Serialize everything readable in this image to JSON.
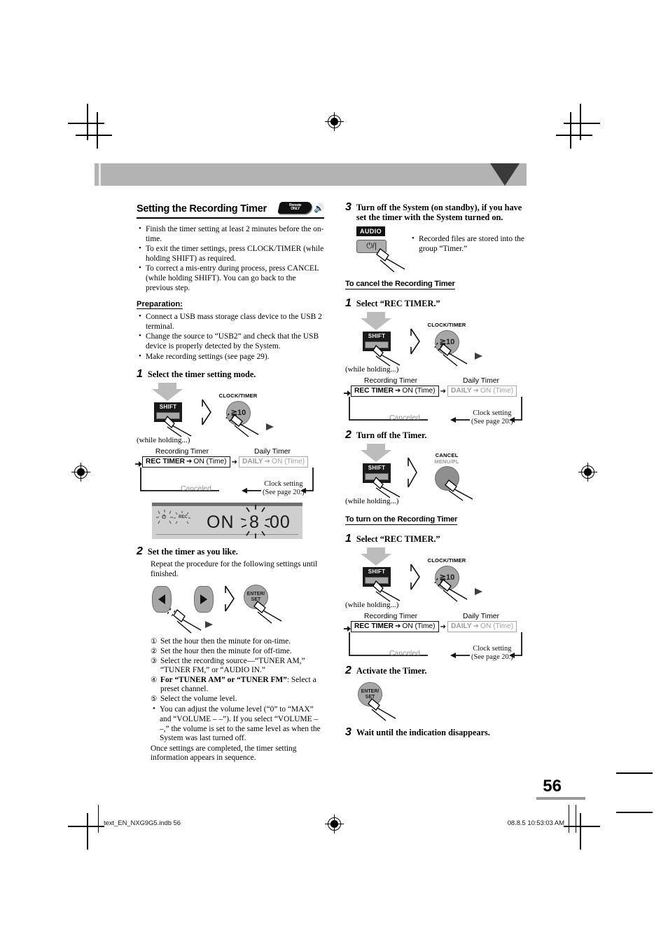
{
  "page": {
    "number": "56",
    "footer_left": "text_EN_NXG9G5.indb   56",
    "footer_right": "08.8.5   10:53:03 AM"
  },
  "left": {
    "title": "Setting the Recording Timer",
    "remote_badge": {
      "line1": "Remote",
      "line2": "ONLY"
    },
    "bullets": [
      "Finish the timer setting at least 2 minutes before the on-time.",
      "To exit the timer settings, press CLOCK/TIMER (while holding SHIFT) as required.",
      "To correct a mis-entry during process, press CANCEL (while holding SHIFT). You can go back to the previous step."
    ],
    "preparation_heading": "Preparation:",
    "preparation_bullets": [
      "Connect a USB mass storage class device to the USB 2 terminal.",
      "Change the source to “USB2” and check that the USB device is properly detected by the System.",
      "Make recording settings (see page 29)."
    ],
    "step1": {
      "n": "1",
      "text": "Select the timer setting mode."
    },
    "art1": {
      "shift_label": "SHIFT",
      "clock_label": "CLOCK/TIMER",
      "key_label": "≧10",
      "while_holding": "(while holding...)"
    },
    "flow": {
      "head_left": "Recording Timer",
      "head_right": "Daily Timer",
      "box1_bold": "REC TIMER",
      "box1_rest": "ON (Time)",
      "box2_bold": "DAILY",
      "box2_rest": "ON (Time)",
      "canceled": "Canceled",
      "clock_l1": "Clock setting",
      "clock_l2": "(See page 20.)"
    },
    "lcd": {
      "rec": "REC",
      "on": "ON",
      "hour": "8",
      "minute": "00"
    },
    "step2": {
      "n": "2",
      "text": "Set the timer as you like."
    },
    "step2_intro": "Repeat the procedure for the following settings until finished.",
    "art2": {
      "enter_l1": "ENTER/",
      "enter_l2": "SET"
    },
    "step2_items": [
      {
        "num": "①",
        "text": "Set the hour then the minute for on-time."
      },
      {
        "num": "②",
        "text": "Set the hour then the minute for off-time."
      },
      {
        "num": "③",
        "text": "Select the recording source—“TUNER AM,” “TUNER FM,” or “AUDIO IN.”"
      },
      {
        "num": "④",
        "text_bold": "For “TUNER AM” or “TUNER FM”",
        "text": ": Select a preset channel."
      },
      {
        "num": "⑤",
        "text": "Select the volume level."
      }
    ],
    "step2_note": "You can adjust the volume level (“0” to “MAX” and “VOLUME – –”). If you select “VOLUME – –,” the volume is set to the same level as when the System was last turned off.",
    "step2_tail": "Once settings are completed, the timer setting information appears in sequence."
  },
  "right": {
    "step3": {
      "n": "3",
      "text": "Turn off the System (on standby), if you have set the timer with the System turned on."
    },
    "audio": {
      "badge": "AUDIO",
      "power_glyph": "⏻/|"
    },
    "step3_note": "Recorded files are stored into the group “Timer.”",
    "cancel_heading": "To cancel the Recording Timer",
    "cancel_step1": {
      "n": "1",
      "text": "Select “REC TIMER.”"
    },
    "cancel_step2": {
      "n": "2",
      "text": "Turn off the Timer."
    },
    "cancel_btn": {
      "l1": "CANCEL",
      "l2": "MENU/PL"
    },
    "turnon_heading": "To turn on the Recording Timer",
    "turnon_step1": {
      "n": "1",
      "text": "Select “REC TIMER.”"
    },
    "turnon_step2": {
      "n": "2",
      "text": "Activate the Timer."
    },
    "turnon_step3": {
      "n": "3",
      "text": "Wait until the indication disappears."
    },
    "enter": {
      "l1": "ENTER/",
      "l2": "SET"
    },
    "shift_label": "SHIFT",
    "clock_label": "CLOCK/TIMER",
    "key_label": "≧10",
    "while_holding": "(while holding...)"
  }
}
